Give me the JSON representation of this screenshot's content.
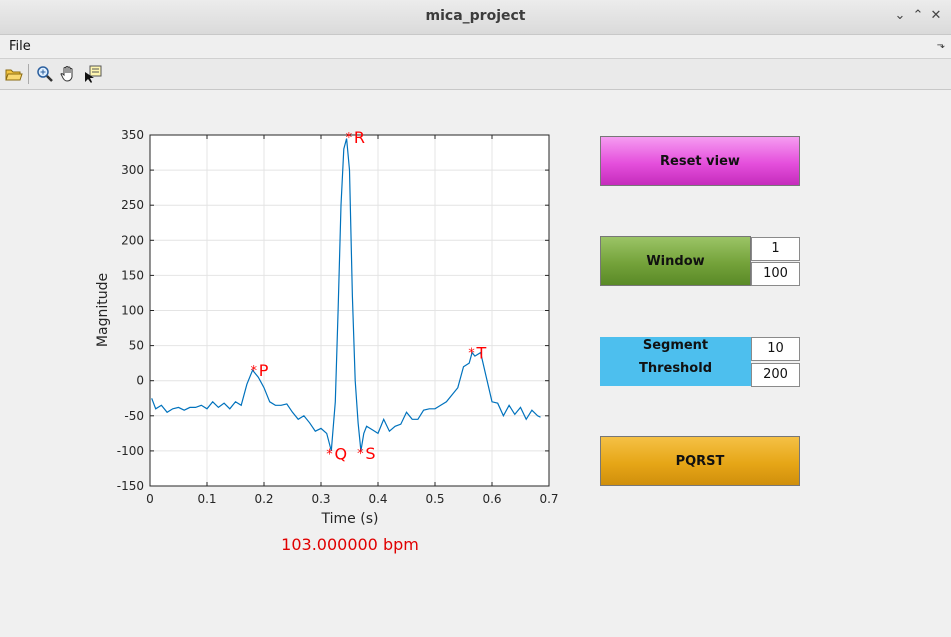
{
  "window": {
    "title": "mica_project"
  },
  "menu": {
    "file": "File",
    "collapse_glyph": "⬎"
  },
  "toolbar": {
    "icons": [
      "open-folder-icon",
      "zoom-in-icon",
      "pan-hand-icon",
      "data-cursor-icon"
    ]
  },
  "controls": {
    "reset_label": "Reset view",
    "window_label": "Window",
    "window_start": "1",
    "window_end": "100",
    "segment_label": "Segment",
    "threshold_label": "Threshold",
    "segment_value": "10",
    "threshold_value": "200",
    "pqrst_label": "PQRST",
    "reset_color": "#e54fdc",
    "window_color": "#74a23a",
    "segment_color": "#4dbfee",
    "pqrst_color": "#e6a617"
  },
  "result": {
    "bpm_text": "103.000000 bpm"
  },
  "chart_data": {
    "type": "line",
    "xlabel": "Time (s)",
    "ylabel": "Magnitude",
    "xlim": [
      0,
      0.7
    ],
    "ylim": [
      -150,
      350
    ],
    "xticks": [
      0,
      0.1,
      0.2,
      0.3,
      0.4,
      0.5,
      0.6,
      0.7
    ],
    "xtick_labels": [
      "0",
      "0.1",
      "0.2",
      "0.3",
      "0.4",
      "0.5",
      "0.6",
      "0.7"
    ],
    "yticks": [
      -150,
      -100,
      -50,
      0,
      50,
      100,
      150,
      200,
      250,
      300,
      350
    ],
    "ytick_labels": [
      "-150",
      "-100",
      "-50",
      "0",
      "50",
      "100",
      "150",
      "200",
      "250",
      "300",
      "350"
    ],
    "grid": true,
    "line_color": "#0072bd",
    "marker_color": "#ff0000",
    "series": [
      {
        "x": [
          0.003,
          0.01,
          0.02,
          0.03,
          0.04,
          0.05,
          0.06,
          0.07,
          0.08,
          0.09,
          0.1,
          0.11,
          0.12,
          0.13,
          0.14,
          0.15,
          0.16,
          0.17,
          0.18,
          0.19,
          0.2,
          0.21,
          0.22,
          0.23,
          0.24,
          0.25,
          0.26,
          0.27,
          0.28,
          0.29,
          0.3,
          0.31,
          0.318,
          0.325,
          0.33,
          0.335,
          0.34,
          0.345,
          0.35,
          0.355,
          0.36,
          0.365,
          0.37,
          0.375,
          0.38,
          0.39,
          0.4,
          0.41,
          0.42,
          0.43,
          0.44,
          0.45,
          0.46,
          0.47,
          0.48,
          0.49,
          0.5,
          0.51,
          0.52,
          0.53,
          0.54,
          0.55,
          0.56,
          0.565,
          0.57,
          0.58,
          0.59,
          0.6,
          0.61,
          0.62,
          0.63,
          0.64,
          0.65,
          0.66,
          0.67,
          0.68,
          0.685
        ],
        "y": [
          -25,
          -40,
          -35,
          -45,
          -40,
          -38,
          -42,
          -38,
          -38,
          -35,
          -40,
          -30,
          -38,
          -32,
          -40,
          -30,
          -35,
          -5,
          15,
          5,
          -10,
          -30,
          -35,
          -35,
          -33,
          -45,
          -55,
          -50,
          -60,
          -72,
          -68,
          -75,
          -100,
          -30,
          100,
          250,
          330,
          345,
          300,
          120,
          0,
          -60,
          -100,
          -75,
          -65,
          -70,
          -75,
          -55,
          -72,
          -65,
          -62,
          -45,
          -55,
          -55,
          -42,
          -40,
          -40,
          -35,
          -30,
          -20,
          -10,
          20,
          25,
          40,
          35,
          40,
          5,
          -30,
          -32,
          -50,
          -35,
          -48,
          -38,
          -55,
          -42,
          -50,
          -52
        ]
      }
    ],
    "annotations": [
      {
        "label": "P",
        "x": 0.182,
        "y": 15
      },
      {
        "label": "Q",
        "x": 0.315,
        "y": -104
      },
      {
        "label": "R",
        "x": 0.349,
        "y": 347
      },
      {
        "label": "S",
        "x": 0.369,
        "y": -103
      },
      {
        "label": "T",
        "x": 0.564,
        "y": 40
      }
    ]
  }
}
